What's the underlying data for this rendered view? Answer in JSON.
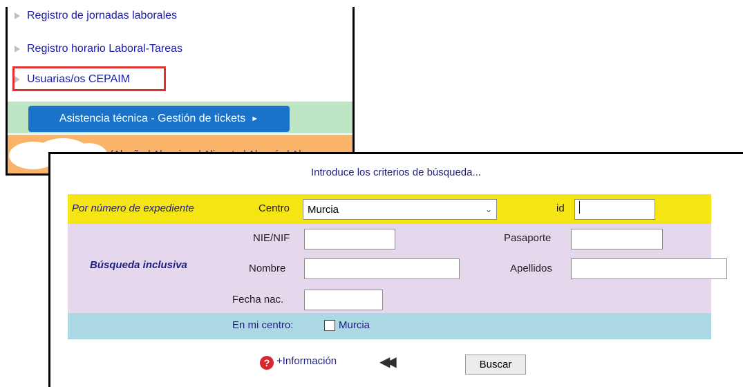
{
  "menu": {
    "items": [
      {
        "label": "Registro de jornadas laborales"
      },
      {
        "label": "Registro horario Laboral-Tareas"
      },
      {
        "label": "Usuarias/os CEPAIM"
      }
    ],
    "ticket_button": "Asistencia técnica - Gestión de tickets",
    "city_links": "(Alcaña | Algeciras | Alicante | Almería | Al"
  },
  "form": {
    "title": "Introduce los criterios de búsqueda...",
    "by_expediente_label": "Por número de expediente",
    "centro_label": "Centro",
    "centro_selected": "Murcia",
    "id_label": "id",
    "id_value": "",
    "inclusive_label": "Búsqueda inclusiva",
    "nie_label": "NIE/NIF",
    "pasaporte_label": "Pasaporte",
    "nombre_label": "Nombre",
    "apellidos_label": "Apellidos",
    "fecha_label": "Fecha nac.",
    "mi_centro_label": "En mi centro:",
    "mi_centro_city": "Murcia",
    "info_link": "+Información",
    "buscar_label": "Buscar"
  },
  "colors": {
    "highlight": "#e03030",
    "ticket_button": "#1a73c8",
    "yellow_row": "#f5e514",
    "purple_row": "#e6d8ec",
    "blue_row": "#acd8e4"
  },
  "icons": [
    "menu-arrow-icon",
    "chevron-down-icon",
    "help-icon",
    "rewind-icon",
    "triangle-right-icon"
  ]
}
